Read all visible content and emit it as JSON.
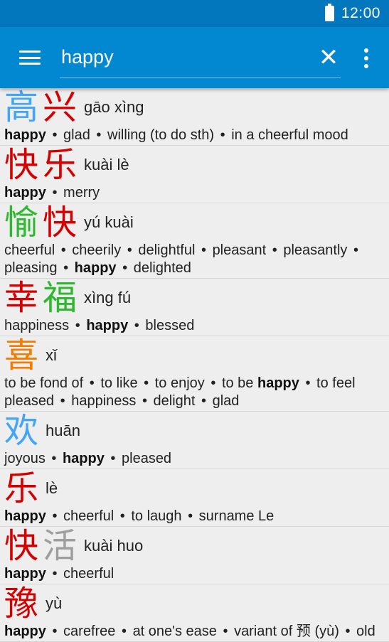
{
  "status_bar": {
    "time": "12:00"
  },
  "search": {
    "value": "happy"
  },
  "colors": {
    "red": "#d50000",
    "blue": "#42a5f5",
    "green": "#2db82d",
    "orange": "#f57c00",
    "gray": "#9e9e9e"
  },
  "entries": [
    {
      "chars": [
        {
          "c": "高",
          "color": "#42a5f5"
        },
        {
          "c": "兴",
          "color": "#d50000"
        }
      ],
      "pinyin": "gāo xìng",
      "defs": [
        [
          "happy",
          true
        ],
        [
          "glad",
          false
        ],
        [
          "willing (to do sth)",
          false
        ],
        [
          "in a cheerful mood",
          false
        ]
      ]
    },
    {
      "chars": [
        {
          "c": "快",
          "color": "#d50000"
        },
        {
          "c": "乐",
          "color": "#d50000"
        }
      ],
      "pinyin": "kuài lè",
      "defs": [
        [
          "happy",
          true
        ],
        [
          "merry",
          false
        ]
      ]
    },
    {
      "chars": [
        {
          "c": "愉",
          "color": "#2db82d"
        },
        {
          "c": "快",
          "color": "#d50000"
        }
      ],
      "pinyin": "yú kuài",
      "defs": [
        [
          "cheerful",
          false
        ],
        [
          "cheerily",
          false
        ],
        [
          "delightful",
          false
        ],
        [
          "pleasant",
          false
        ],
        [
          "pleasantly",
          false
        ],
        [
          "pleasing",
          false
        ],
        [
          "happy",
          true
        ],
        [
          "delighted",
          false
        ]
      ]
    },
    {
      "chars": [
        {
          "c": "幸",
          "color": "#d50000"
        },
        {
          "c": "福",
          "color": "#2db82d"
        }
      ],
      "pinyin": "xìng fú",
      "defs": [
        [
          "happiness",
          false
        ],
        [
          "happy",
          true
        ],
        [
          "blessed",
          false
        ]
      ]
    },
    {
      "chars": [
        {
          "c": "喜",
          "color": "#f57c00"
        }
      ],
      "pinyin": "xǐ",
      "defs": [
        [
          "to be fond of",
          false
        ],
        [
          "to like",
          false
        ],
        [
          "to enjoy",
          false
        ],
        [
          "to be happy",
          "partial"
        ],
        [
          "to feel pleased",
          false
        ],
        [
          "happiness",
          false
        ],
        [
          "delight",
          false
        ],
        [
          "glad",
          false
        ]
      ]
    },
    {
      "chars": [
        {
          "c": "欢",
          "color": "#42a5f5"
        }
      ],
      "pinyin": "huān",
      "defs": [
        [
          "joyous",
          false
        ],
        [
          "happy",
          true
        ],
        [
          "pleased",
          false
        ]
      ]
    },
    {
      "chars": [
        {
          "c": "乐",
          "color": "#d50000"
        }
      ],
      "pinyin": "lè",
      "defs": [
        [
          "happy",
          true
        ],
        [
          "cheerful",
          false
        ],
        [
          "to laugh",
          false
        ],
        [
          "surname Le",
          false
        ]
      ]
    },
    {
      "chars": [
        {
          "c": "快",
          "color": "#d50000"
        },
        {
          "c": "活",
          "color": "#9e9e9e"
        }
      ],
      "pinyin": "kuài huo",
      "defs": [
        [
          "happy",
          true
        ],
        [
          "cheerful",
          false
        ]
      ]
    },
    {
      "chars": [
        {
          "c": "豫",
          "color": "#d50000"
        }
      ],
      "pinyin": "yù",
      "defs": [
        [
          "happy",
          true
        ],
        [
          "carefree",
          false
        ],
        [
          "at one's ease",
          false
        ],
        [
          "variant of 预 (yù)",
          false
        ],
        [
          "old",
          false
        ]
      ]
    }
  ]
}
